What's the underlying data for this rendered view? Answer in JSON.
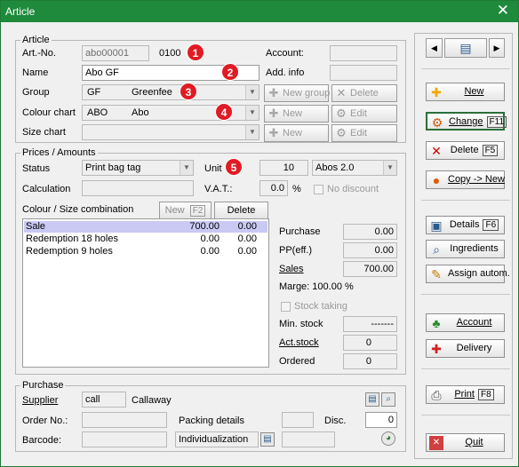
{
  "window": {
    "title": "Article",
    "close_glyph": "✕"
  },
  "article": {
    "group_label": "Article",
    "artno_label": "Art.-No.",
    "artno_value": "abo00001",
    "artno_code": "0100",
    "account_label": "Account:",
    "name_label": "Name",
    "name_value": "Abo GF",
    "addinfo_label": "Add. info",
    "group_field_label": "Group",
    "group_code": "GF",
    "group_name": "Greenfee",
    "new_group_label": "New group",
    "delete_label": "Delete",
    "colour_label": "Colour chart",
    "colour_code": "ABO",
    "colour_name": "Abo",
    "new_label": "New",
    "edit_label": "Edit",
    "size_label": "Size chart"
  },
  "prices": {
    "group_label": "Prices / Amounts",
    "status_label": "Status",
    "status_value": "Print bag tag",
    "unit_label": "Unit",
    "unit_qty": "10",
    "unit_value": "Abos 2.0",
    "calc_label": "Calculation",
    "vat_label": "V.A.T.:",
    "vat_value": "0.0",
    "vat_unit": "%",
    "no_discount_label": "No discount",
    "combo_label": "Colour / Size combination",
    "combo_new_label": "New",
    "combo_new_key": "F2",
    "combo_delete_label": "Delete",
    "rows": [
      {
        "name": "Sale",
        "a": "700.00",
        "b": "0.00"
      },
      {
        "name": "Redemption 18 holes",
        "a": "0.00",
        "b": "0.00"
      },
      {
        "name": "Redemption 9 holes",
        "a": "0.00",
        "b": "0.00"
      }
    ],
    "purchase_label": "Purchase",
    "purchase_value": "0.00",
    "pp_label": "PP(eff.)",
    "pp_value": "0.00",
    "sales_label": "Sales",
    "sales_value": "700.00",
    "marge_text": "Marge: 100.00 %",
    "stock_taking_label": "Stock taking",
    "min_stock_label": "Min. stock",
    "min_stock_value": "-------",
    "act_stock_label": "Act.stock",
    "act_stock_value": "0",
    "ordered_label": "Ordered",
    "ordered_value": "0"
  },
  "purchase": {
    "group_label": "Purchase",
    "supplier_label": "Supplier",
    "supplier_code": "call",
    "supplier_name": "Callaway",
    "orderno_label": "Order No.:",
    "packing_label": "Packing details",
    "disc_label": "Disc.",
    "disc_value": "0",
    "barcode_label": "Barcode:",
    "individual_value": "Individualization"
  },
  "badges": [
    "1",
    "2",
    "3",
    "4",
    "5"
  ],
  "sidebar": {
    "new_label": "New",
    "change_label": "Change",
    "change_key": "F11",
    "delete_label": "Delete",
    "delete_key": "F5",
    "copy_label": "Copy -> New",
    "details_label": "Details",
    "details_key": "F6",
    "ingredients_label": "Ingredients",
    "assign_label": "Assign autom.",
    "account_label": "Account",
    "delivery_label": "Delivery",
    "print_label": "Print",
    "print_key": "F8",
    "quit_label": "Quit"
  },
  "colors": {
    "title_bg": "#1f8a3c",
    "badge": "#e01b24",
    "selection": "#c9c9f3"
  }
}
